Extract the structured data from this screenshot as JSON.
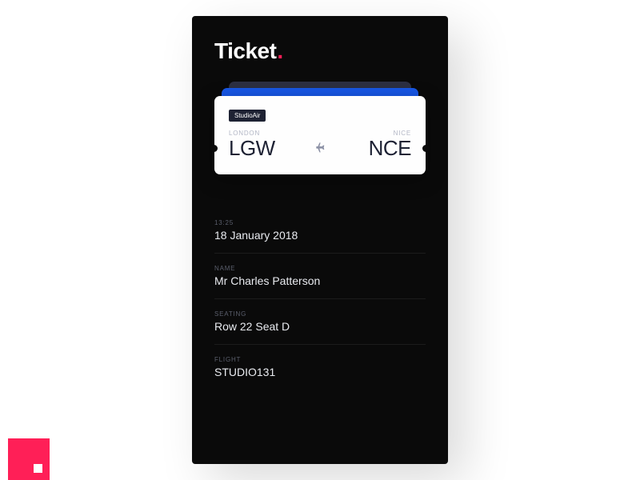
{
  "header": {
    "title": "Ticket",
    "dot": "."
  },
  "ticket": {
    "airline": "StudioAir",
    "origin_city": "LONDON",
    "origin_code": "LGW",
    "dest_city": "NICE",
    "dest_code": "NCE"
  },
  "details": [
    {
      "label": "13:25",
      "value": "18 January 2018"
    },
    {
      "label": "NAME",
      "value": "Mr Charles Patterson"
    },
    {
      "label": "SEATING",
      "value": "Row 22 Seat D"
    },
    {
      "label": "FLIGHT",
      "value": "STUDIO131"
    }
  ]
}
